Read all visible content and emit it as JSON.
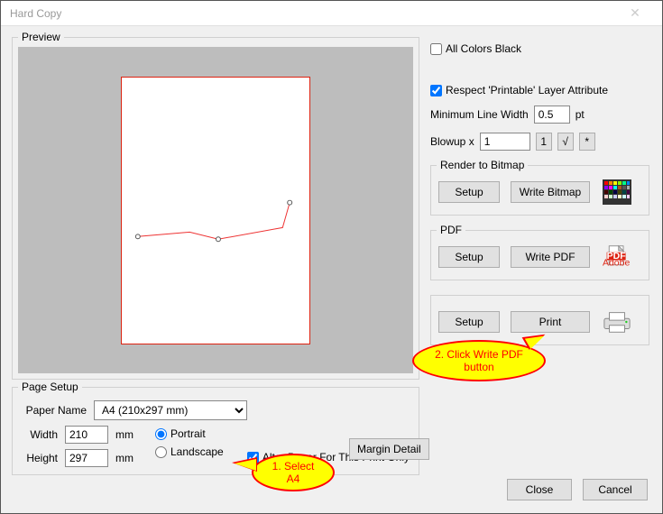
{
  "window": {
    "title": "Hard Copy"
  },
  "preview": {
    "label": "Preview"
  },
  "options": {
    "all_colors_black_label": "All Colors Black",
    "all_colors_black_checked": false,
    "respect_printable_label": "Respect 'Printable' Layer Attribute",
    "respect_printable_checked": true,
    "min_line_width_label": "Minimum Line Width",
    "min_line_width_value": "0.5",
    "min_line_width_unit": "pt",
    "blowup_label": "Blowup  x",
    "blowup_value": "1",
    "blowup_buttons": {
      "one": "1",
      "sqrt": "√",
      "star": "*"
    }
  },
  "render_bitmap": {
    "title": "Render to Bitmap",
    "setup": "Setup",
    "write": "Write Bitmap"
  },
  "pdf": {
    "title": "PDF",
    "setup": "Setup",
    "write": "Write PDF"
  },
  "printer": {
    "setup": "Setup",
    "print": "Print"
  },
  "pagesetup": {
    "title": "Page Setup",
    "paper_name_label": "Paper Name",
    "paper_name_value": "A4   (210x297 mm)",
    "width_label": "Width",
    "width_value": "210",
    "height_label": "Height",
    "height_value": "297",
    "unit": "mm",
    "portrait_label": "Portrait",
    "landscape_label": "Landscape",
    "orientation": "portrait",
    "alter_paper_label": "Alter Paper For This Print Only",
    "alter_paper_checked": true,
    "margin_detail": "Margin Detail"
  },
  "buttons": {
    "close": "Close",
    "cancel": "Cancel"
  },
  "callouts": {
    "c1_line1": "1. Select",
    "c1_line2": "A4",
    "c2_line1": "2. Click Write PDF",
    "c2_line2": "button"
  }
}
